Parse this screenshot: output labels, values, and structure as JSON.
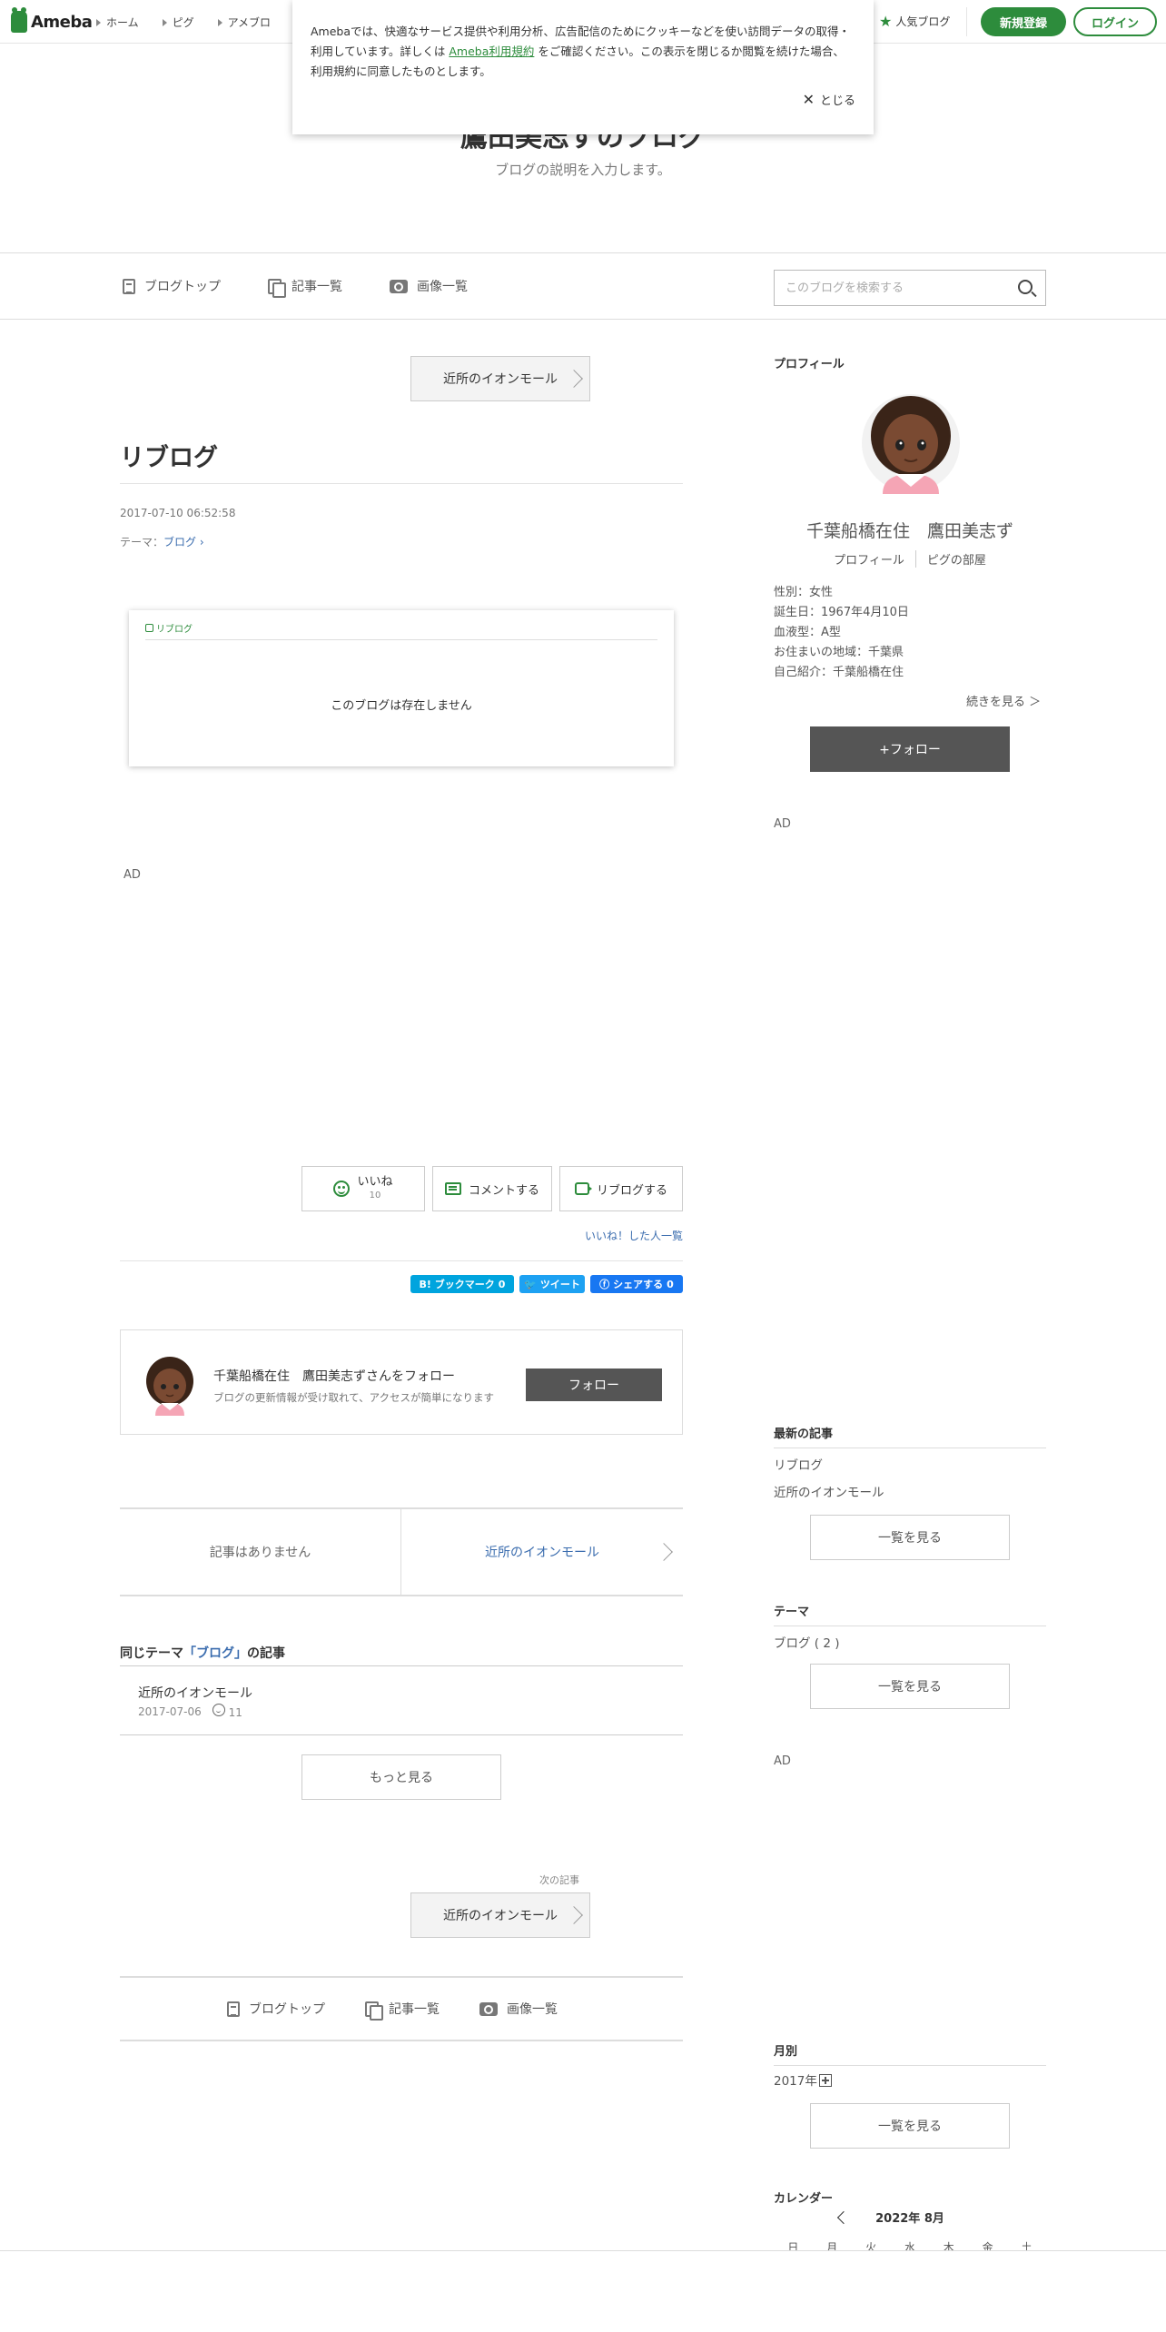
{
  "global_header": {
    "logo_text": "Ameba",
    "nav": [
      "ホーム",
      "ピグ",
      "アメブロ"
    ],
    "popular_blog": "人気ブログ",
    "register_label": "新規登録",
    "login_label": "ログイン"
  },
  "cookie_banner": {
    "text_before": "Amebaでは、快適なサービス提供や利用分析、広告配信のためにクッキーなどを使い訪問データの取得・利用しています。詳しくは",
    "terms_link": "Ameba利用規約",
    "text_after": "をご確認ください。この表示を閉じるか閲覧を続けた場合、利用規約に同意したものとします。",
    "close_label": "とじる"
  },
  "blog": {
    "title": "鷹田美志ずのブログ",
    "description": "ブログの説明を入力します。"
  },
  "blog_nav": {
    "top": "ブログトップ",
    "entries": "記事一覧",
    "images": "画像一覧",
    "search_placeholder": "このブログを検索する"
  },
  "entry": {
    "prev_label": "近所のイオンモール",
    "title": "リブログ",
    "date": "2017-07-10 06:52:58",
    "theme_prefix": "テーマ：",
    "theme": "ブログ",
    "reblog_label": "リブログ",
    "reblog_message": "このブログは存在しません",
    "ad_label": "AD",
    "like_label": "いいね",
    "like_count": "10",
    "comment_label": "コメントする",
    "reblog_action_label": "リブログする",
    "likers_link": "いいね！した人一覧"
  },
  "share": {
    "hatena": "B! ブックマーク",
    "hatena_count": "0",
    "tweet": "ツイート",
    "facebook": "シェアする",
    "facebook_count": "0",
    "colors": {
      "hatena": "#00a4de",
      "twitter": "#1da1f2",
      "facebook": "#1877f2"
    }
  },
  "follow_box": {
    "name": "千葉船橋在住　鷹田美志ずさんをフォロー",
    "description": "ブログの更新情報が受け取れて、アクセスが簡単になります",
    "button": "フォロー"
  },
  "pager": {
    "newer": "記事はありません",
    "older": "近所のイオンモール"
  },
  "same_theme": {
    "prefix": "同じテーマ",
    "theme": "「ブログ」",
    "suffix": "の記事",
    "items": [
      {
        "title": "近所のイオンモール",
        "date": "2017-07-06",
        "likes": "11"
      }
    ],
    "more_label": "もっと見る"
  },
  "next_entry": {
    "label": "次の記事",
    "title": "近所のイオンモール"
  },
  "bottom_nav": {
    "top": "ブログトップ",
    "entries": "記事一覧",
    "images": "画像一覧"
  },
  "sidebar": {
    "profile_heading": "プロフィール",
    "profile_name": "千葉船橋在住　鷹田美志ず",
    "profile_link": "プロフィール",
    "pig_link": "ピグの部屋",
    "info": [
      "性別：女性",
      "誕生日：1967年4月10日",
      "血液型：A型",
      "お住まいの地域：千葉県",
      "自己紹介：千葉船橋在住"
    ],
    "more_link": "続きを見る ＞",
    "follow_button": "+フォロー",
    "ad_label": "AD",
    "latest_heading": "最新の記事",
    "latest": [
      "リブログ",
      "近所のイオンモール"
    ],
    "list_label": "一覧を見る",
    "theme_heading": "テーマ",
    "themes": [
      "ブログ ( 2 )"
    ],
    "ad_label_2": "AD",
    "monthly_heading": "月別",
    "months": [
      "2017年"
    ],
    "calendar_heading": "カレンダー",
    "calendar_month": "2022年 8月",
    "weekdays": [
      "日",
      "月",
      "火",
      "水",
      "木",
      "金",
      "土"
    ]
  }
}
